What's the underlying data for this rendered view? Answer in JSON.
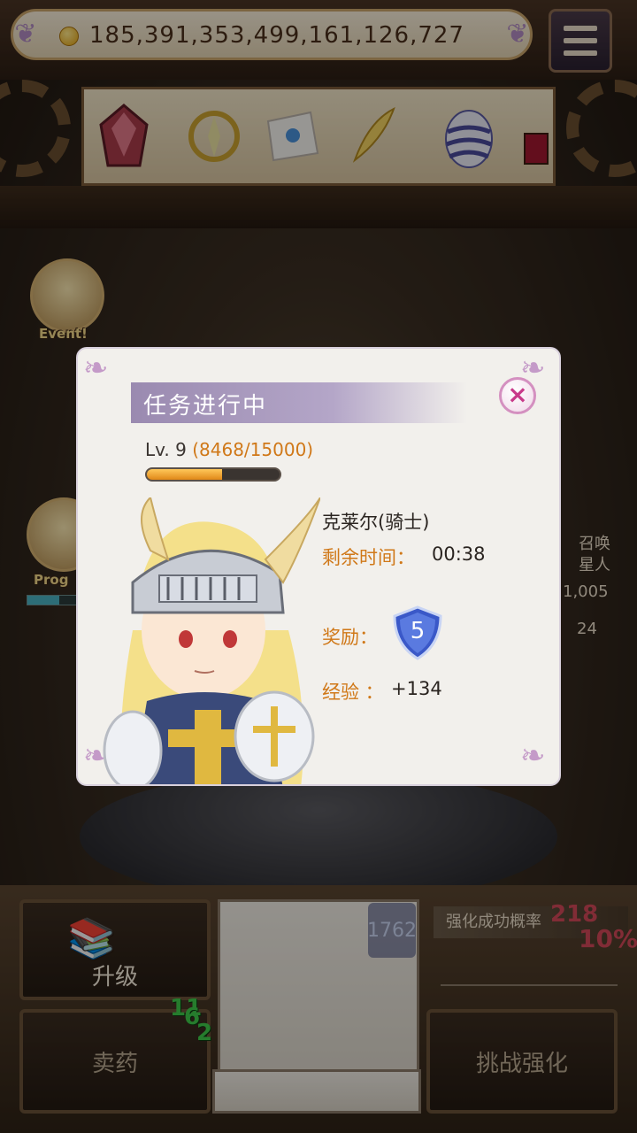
{
  "header": {
    "coins": "185,391,353,499,161,126,727"
  },
  "shelf": {
    "items": [
      {
        "icon": "crystal-icon"
      },
      {
        "icon": "emblem-icon"
      },
      {
        "icon": "map-icon"
      },
      {
        "icon": "feather-icon"
      },
      {
        "icon": "egg-icon"
      },
      {
        "icon": "potion-icon"
      }
    ]
  },
  "side": {
    "event_label": "Event!",
    "progress_label": "Prog",
    "right_labels": [
      "召唤",
      "星人"
    ],
    "right_value_1": "1,005",
    "right_value_2": "24"
  },
  "dialog": {
    "title": "任务进行中",
    "close_label": "×",
    "level_text": "Lv. 9",
    "exp_text": "(8468/15000)",
    "exp_progress": 0.5645,
    "character_name": "克莱尔(骑士)",
    "time_label": "剩余时间：",
    "time_value": "00:38",
    "reward_label": "奖励：",
    "reward_value": "5",
    "exp_label": "经验 ：",
    "exp_value": "+134"
  },
  "bottom": {
    "upgrade_label": "升级",
    "sell_label": "卖药",
    "challenge_label": "挑战强化",
    "badge_value": "1762",
    "strength_label": "强化成功概率",
    "rate_number": "218",
    "rate_percent": "10%",
    "green_1": "11",
    "green_2": "6",
    "green_3": "2"
  },
  "colors": {
    "accent_orange": "#d07818",
    "title_purple": "#9a8ab0",
    "close_pink": "#c83a8a"
  }
}
